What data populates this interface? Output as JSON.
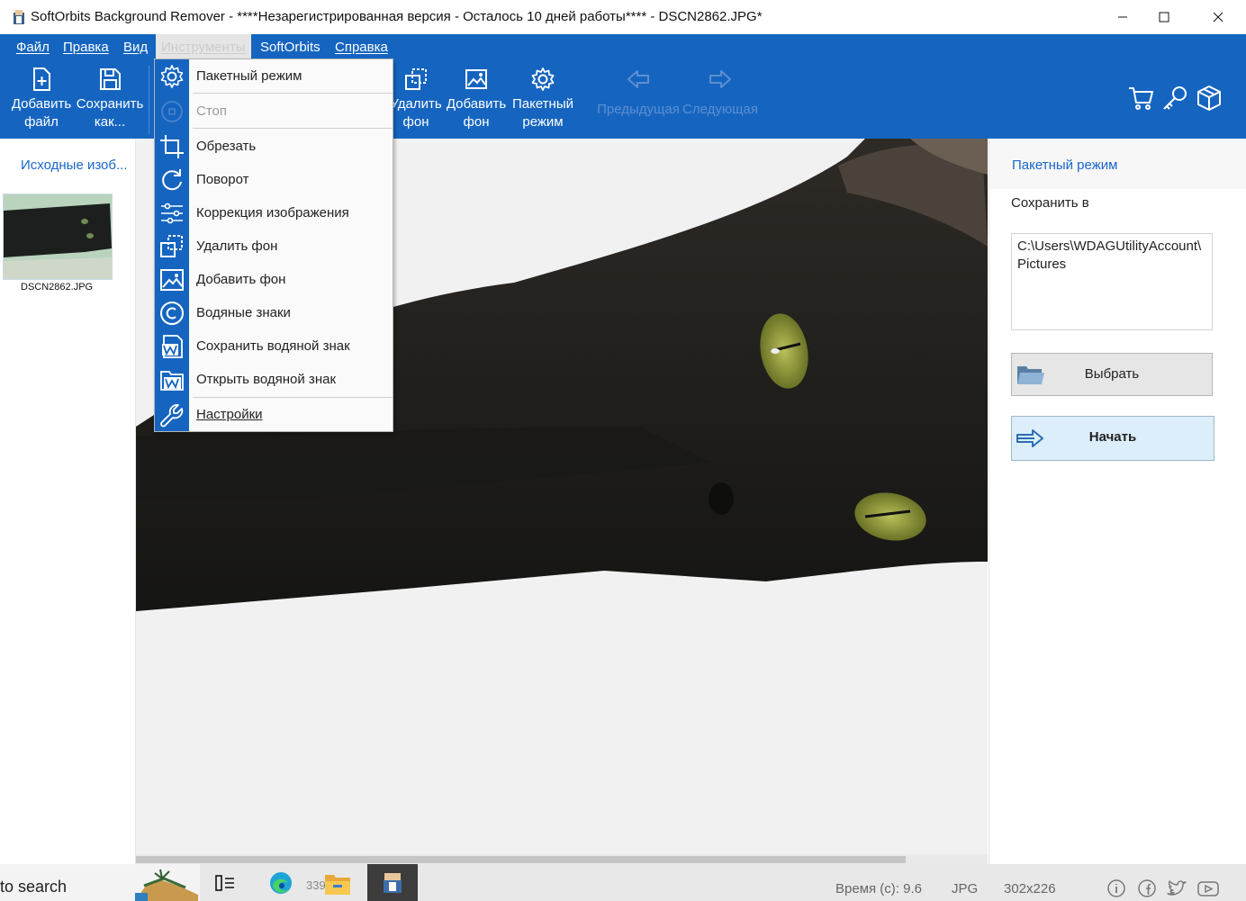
{
  "window": {
    "title": "SoftOrbits Background Remover - ****Незарегистрированная версия - Осталось 10 дней работы**** - DSCN2862.JPG*",
    "minimize": "—",
    "maximize": "☐",
    "close": "✕"
  },
  "menu": {
    "file": "Файл",
    "edit": "Правка",
    "view": "Вид",
    "tools": "Инструменты",
    "softorbits": "SoftOrbits",
    "help": "Справка"
  },
  "toolbar": {
    "add_file": [
      "Добавить",
      "файл"
    ],
    "save_as": [
      "Сохранить",
      "как..."
    ],
    "remove_bg": [
      "Удалить",
      "фон"
    ],
    "add_bg": [
      "Добавить",
      "фон"
    ],
    "batch": [
      "Пакетный",
      "режим"
    ],
    "prev": "Предыдущая",
    "next": "Следующая"
  },
  "tools_menu": {
    "items": [
      {
        "label": "Пакетный режим",
        "icon": "gear-icon"
      },
      {
        "label": "Стоп",
        "icon": "stop-icon",
        "disabled": true
      },
      {
        "label": "Обрезать",
        "icon": "crop-icon"
      },
      {
        "label": "Поворот",
        "icon": "rotate-icon"
      },
      {
        "label": "Коррекция изображения",
        "icon": "sliders-icon"
      },
      {
        "label": "Удалить фон",
        "icon": "remove-bg-icon"
      },
      {
        "label": "Добавить фон",
        "icon": "image-icon"
      },
      {
        "label": "Водяные знаки",
        "icon": "copyright-icon"
      },
      {
        "label": "Сохранить водяной знак",
        "icon": "save-watermark-icon"
      },
      {
        "label": "Открыть водяной знак",
        "icon": "open-watermark-icon"
      },
      {
        "label": "Настройки",
        "icon": "wrench-icon"
      }
    ]
  },
  "left_panel": {
    "title": "Исходные изоб...",
    "thumbnail_name": "DSCN2862.JPG"
  },
  "right_panel": {
    "title": "Пакетный режим",
    "save_to_label": "Сохранить в",
    "path": "C:\\Users\\WDAGUtilityAccount\\Pictures",
    "choose_button": "Выбрать",
    "start_button": "Начать"
  },
  "taskbar": {
    "search": "to search",
    "edge_badge": "339"
  },
  "status": {
    "time": "Время (с): 9.6",
    "format": "JPG",
    "size": "302x226"
  },
  "colors": {
    "accent": "#1565c0",
    "link": "#1a66c8"
  }
}
